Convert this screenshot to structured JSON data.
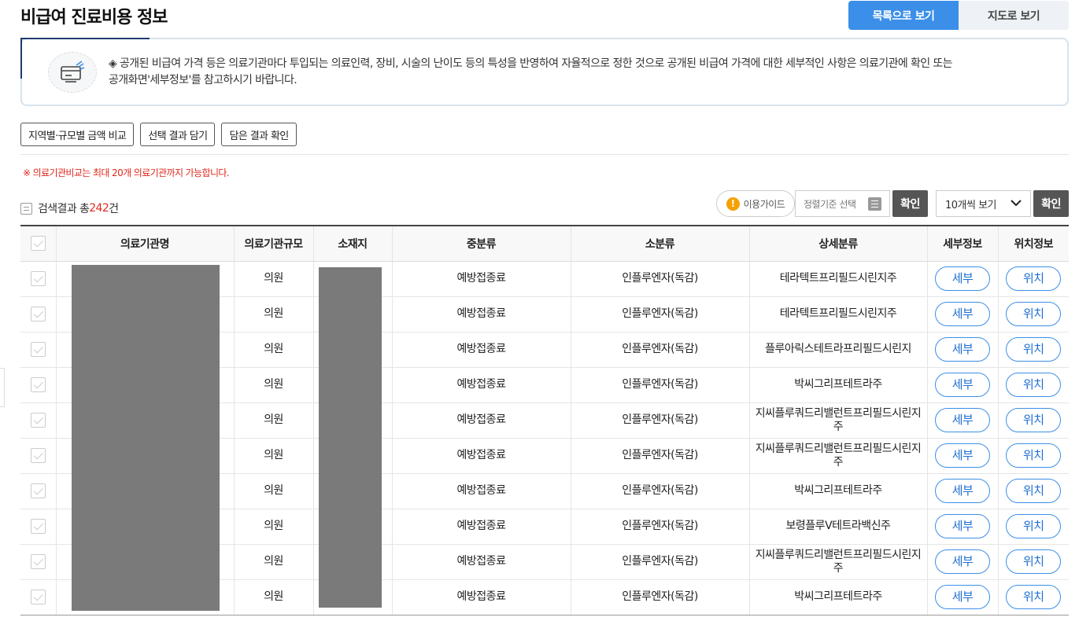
{
  "header": {
    "title": "비급여 진료비용 정보",
    "view_list_label": "목록으로 보기",
    "view_map_label": "지도로 보기"
  },
  "notice": {
    "text_line1": "◈ 공개된 비급여 가격 등은 의료기관마다 투입되는 의료인력, 장비, 시술의 난이도 등의 특성을 반영하여 자율적으로 정한 것으로 공개된 비급여 가격에 대한 세부적인 사항은 의료기관에 확인 또는",
    "text_line2": "공개화면'세부정보'를 참고하시기 바랍니다."
  },
  "actions": {
    "compare_label": "지역별·규모별 금액 비교",
    "save_label": "선택 결과 담기",
    "view_saved_label": "담은 결과 확인"
  },
  "warning": "※ 의료기관비교는 최대 20개 의료기관까지 가능합니다.",
  "results": {
    "prefix": "검색결과 총",
    "count": "242",
    "suffix": "건"
  },
  "controls": {
    "guide_label": "이용가이드",
    "sort_placeholder": "정렬기준 선택",
    "confirm_label": "확인",
    "per_page_value": "10개씩 보기",
    "confirm2_label": "확인"
  },
  "table": {
    "headers": [
      "의료기관명",
      "의료기관규모",
      "소재지",
      "중분류",
      "소분류",
      "상세분류",
      "세부정보",
      "위치정보"
    ],
    "rows": [
      {
        "scale": "의원",
        "mid": "예방접종료",
        "sub": "인플루엔자(독감)",
        "detail": "테라텍트프리필드시린지주"
      },
      {
        "scale": "의원",
        "mid": "예방접종료",
        "sub": "인플루엔자(독감)",
        "detail": "테라텍트프리필드시린지주"
      },
      {
        "scale": "의원",
        "mid": "예방접종료",
        "sub": "인플루엔자(독감)",
        "detail": "플루아릭스테트라프리필드시린지"
      },
      {
        "scale": "의원",
        "mid": "예방접종료",
        "sub": "인플루엔자(독감)",
        "detail": "박씨그리프테트라주"
      },
      {
        "scale": "의원",
        "mid": "예방접종료",
        "sub": "인플루엔자(독감)",
        "detail": "지씨플루쿼드리밸런트프리필드시린지주"
      },
      {
        "scale": "의원",
        "mid": "예방접종료",
        "sub": "인플루엔자(독감)",
        "detail": "지씨플루쿼드리밸런트프리필드시린지주"
      },
      {
        "scale": "의원",
        "mid": "예방접종료",
        "sub": "인플루엔자(독감)",
        "detail": "박씨그리프테트라주"
      },
      {
        "scale": "의원",
        "mid": "예방접종료",
        "sub": "인플루엔자(독감)",
        "detail": "보령플루Ⅴ테트라백신주"
      },
      {
        "scale": "의원",
        "mid": "예방접종료",
        "sub": "인플루엔자(독감)",
        "detail": "지씨플루쿼드리밸런트프리필드시린지주"
      },
      {
        "scale": "의원",
        "mid": "예방접종료",
        "sub": "인플루엔자(독감)",
        "detail": "박씨그리프테트라주"
      }
    ],
    "detail_btn_label": "세부",
    "location_btn_label": "위치"
  },
  "colors": {
    "accent": "#3b8fe8",
    "warning": "#e0281e",
    "dark_button": "#555555"
  }
}
